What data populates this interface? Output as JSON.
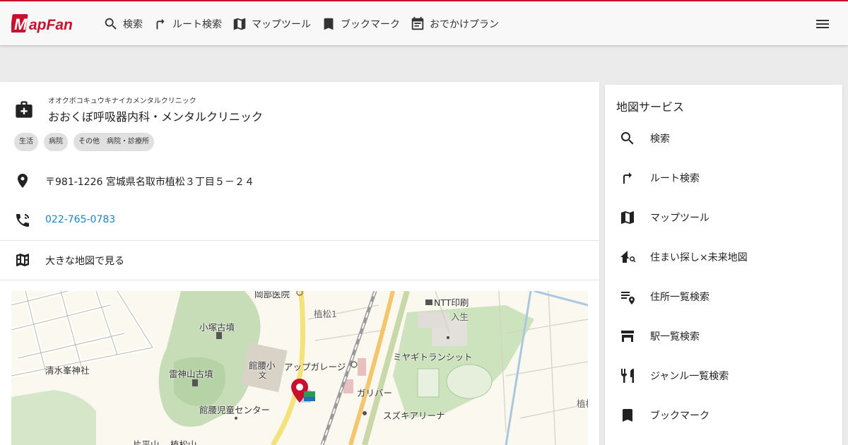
{
  "header": {
    "logo_text": "MapFan",
    "brand_color": "#c8102e",
    "nav": [
      {
        "icon": "search-icon",
        "label": "検索"
      },
      {
        "icon": "route-icon",
        "label": "ルート検索"
      },
      {
        "icon": "map-icon",
        "label": "マップツール"
      },
      {
        "icon": "bookmark-icon",
        "label": "ブックマーク"
      },
      {
        "icon": "calendar-icon",
        "label": "おでかけプラン"
      }
    ],
    "menu_icon": "hamburger-menu-icon"
  },
  "place": {
    "icon": "hospital-icon",
    "kana": "オオクボコキュウキナイカメンタルクリニック",
    "name": "おおくぼ呼吸器内科・メンタルクリニック",
    "tags": [
      "生活",
      "病院",
      "その他　病院・診療所"
    ],
    "address": "〒981-1226 宮城県名取市植松３丁目５－２４",
    "phone": "022-765-0783",
    "phone_color": "#1a84c7",
    "large_map": "大きな地図で見る"
  },
  "map": {
    "labels": {
      "okabe": "岡部医院",
      "uematsu1": "植松1",
      "ntt": "NTT印刷",
      "iriu": "入生",
      "kozuka": "小塚古墳",
      "shimizu": "清水峯神社",
      "raijin": "雷神山古墳",
      "tatekoshi": "館腰小",
      "bun": "文",
      "upgarage": "アップガレージ",
      "miyagi": "ミヤギトランシット",
      "gulliver": "ガリバー",
      "jido": "館腰児童センター",
      "suzuki": "スズキアリーナ",
      "uematsu_edge": "植松",
      "katahirayama": "片平山",
      "uematsuyama": "植松山"
    },
    "marker_color": "#c8102e"
  },
  "side": {
    "title": "地図サービス",
    "items": [
      {
        "icon": "search-icon",
        "label": "検索"
      },
      {
        "icon": "route-icon",
        "label": "ルート検索"
      },
      {
        "icon": "map-icon",
        "label": "マップツール"
      },
      {
        "icon": "house-search-icon",
        "label": "住まい探し×未来地図"
      },
      {
        "icon": "address-list-icon",
        "label": "住所一覧検索"
      },
      {
        "icon": "station-icon",
        "label": "駅一覧検索"
      },
      {
        "icon": "restaurant-icon",
        "label": "ジャンル一覧検索"
      },
      {
        "icon": "bookmark-icon",
        "label": "ブックマーク"
      }
    ]
  }
}
